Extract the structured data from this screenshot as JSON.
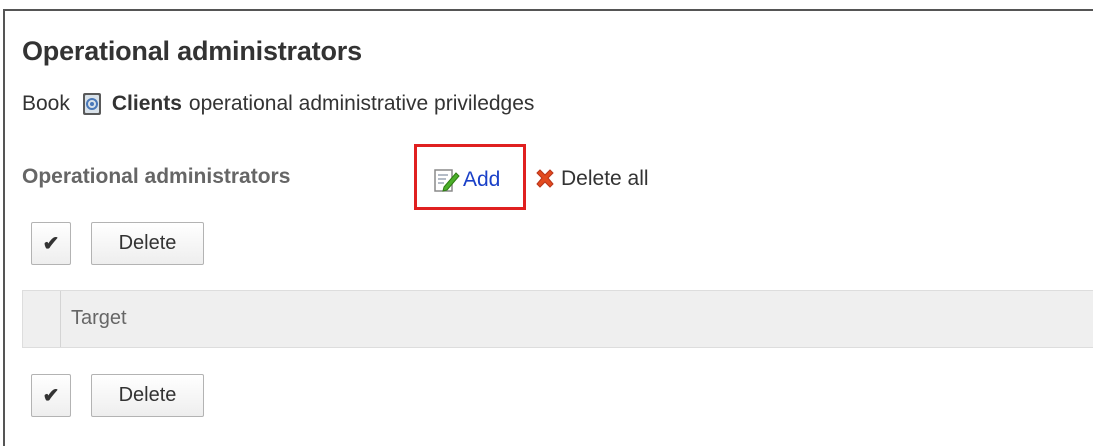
{
  "header": {
    "title": "Operational administrators",
    "subtitle_prefix": "Book",
    "book_name": "Clients",
    "subtitle_suffix": "operational administrative priviledges"
  },
  "section": {
    "label": "Operational administrators",
    "add_label": "Add",
    "delete_all_label": "Delete all"
  },
  "toolbar_top": {
    "check_glyph": "✔",
    "delete_label": "Delete"
  },
  "table": {
    "columns": [
      "Target"
    ]
  },
  "toolbar_bottom": {
    "check_glyph": "✔",
    "delete_label": "Delete"
  },
  "colors": {
    "link": "#1a40c8",
    "highlight_box": "#e02020",
    "delete_x": "#e24a1f"
  },
  "icons": {
    "book": "address-book-icon",
    "add": "edit-add-icon",
    "delete_all": "delete-x-icon"
  }
}
